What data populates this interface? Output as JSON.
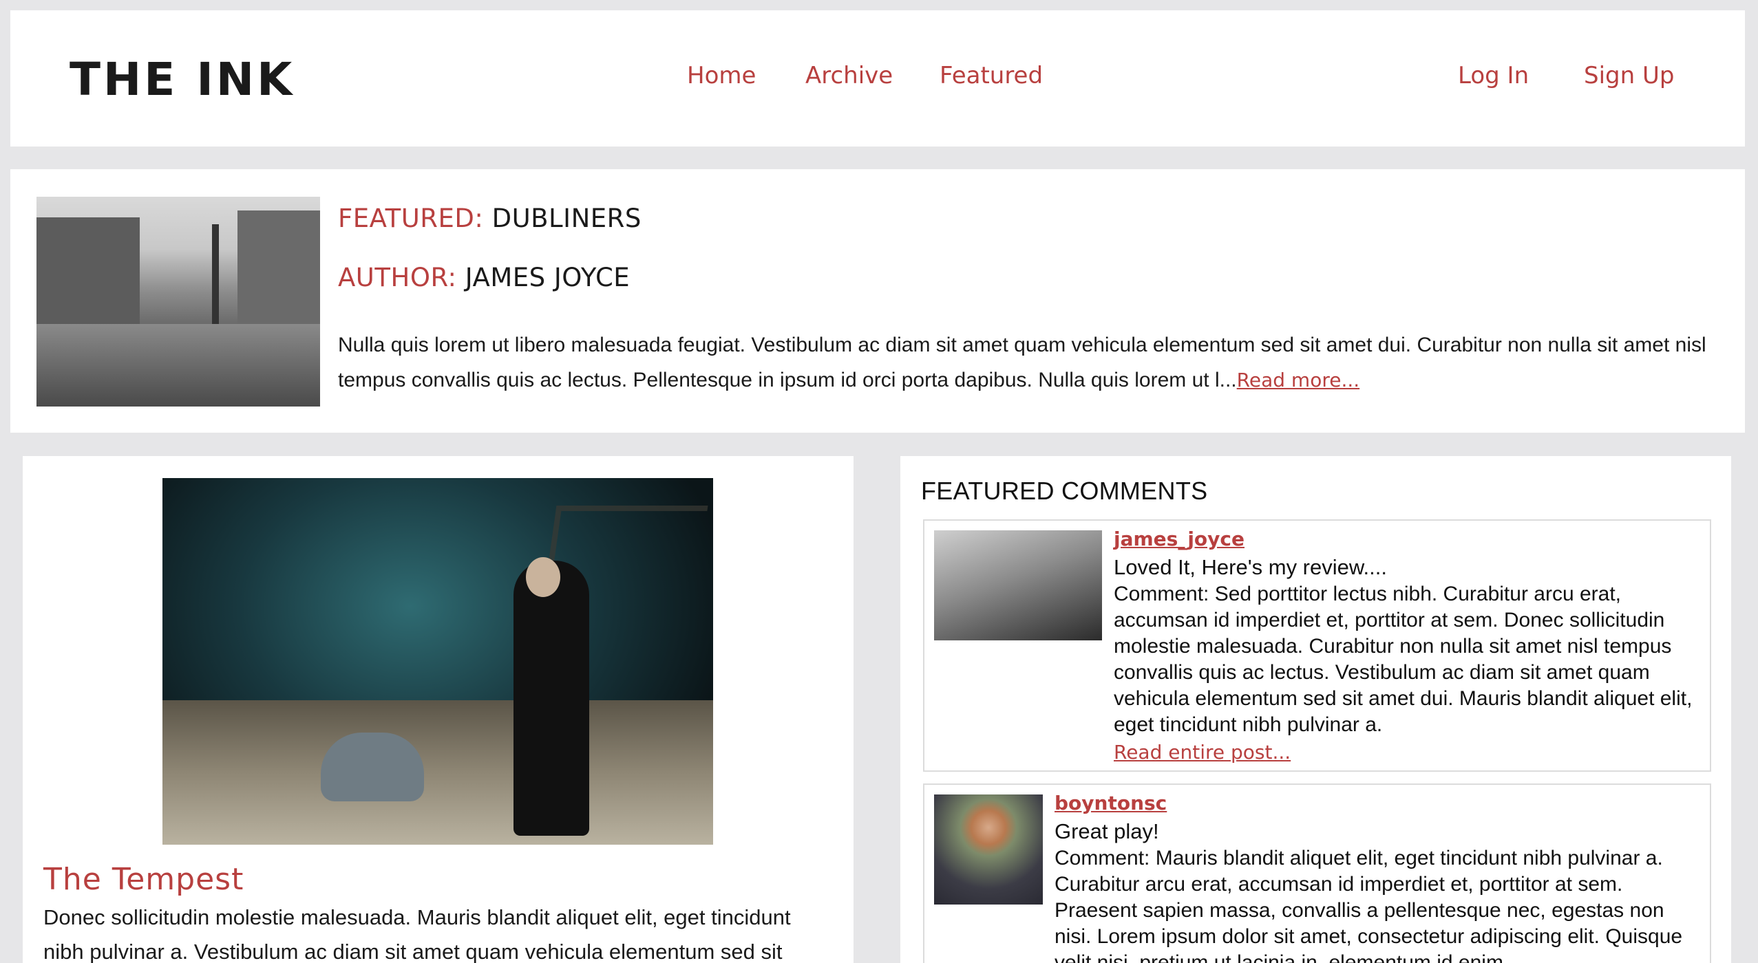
{
  "header": {
    "logo": "THE INK",
    "nav": [
      "Home",
      "Archive",
      "Featured"
    ],
    "auth": [
      "Log In",
      "Sign Up"
    ]
  },
  "feature": {
    "featured_label": "FEATURED:",
    "featured_value": "DUBLINERS",
    "author_label": "AUTHOR:",
    "author_value": "JAMES JOYCE",
    "excerpt": "Nulla quis lorem ut libero malesuada feugiat. Vestibulum ac diam sit amet quam vehicula elementum sed sit amet dui. Curabitur non nulla sit amet nisl tempus convallis quis ac lectus. Pellentesque in ipsum id orci porta dapibus. Nulla quis lorem ut l...",
    "read_more": "Read more..."
  },
  "article": {
    "title": "The Tempest",
    "body": "Donec sollicitudin molestie malesuada. Mauris blandit aliquet elit, eget tincidunt nibh pulvinar a. Vestibulum ac diam sit amet quam vehicula elementum sed sit"
  },
  "comments": {
    "heading": "FEATURED COMMENTS",
    "items": [
      {
        "user": "james_joyce",
        "headline": "Loved It, Here's my review....",
        "text": "Comment: Sed porttitor lectus nibh. Curabitur arcu erat, accumsan id imperdiet et, porttitor at sem. Donec sollicitudin molestie malesuada. Curabitur non nulla sit amet nisl tempus convallis quis ac lectus. Vestibulum ac diam sit amet quam vehicula elementum sed sit amet dui. Mauris blandit aliquet elit, eget tincidunt nibh pulvinar a.",
        "more": "Read entire post..."
      },
      {
        "user": "boyntonsc",
        "headline": "Great play!",
        "text": "Comment: Mauris blandit aliquet elit, eget tincidunt nibh pulvinar a. Curabitur arcu erat, accumsan id imperdiet et, porttitor at sem. Praesent sapien massa, convallis a pellentesque nec, egestas non nisi. Lorem ipsum dolor sit amet, consectetur adipiscing elit. Quisque velit nisi, pretium ut lacinia in, elementum id enim.",
        "more": ""
      }
    ]
  },
  "colors": {
    "accent": "#b8403f",
    "background": "#e6e6e8",
    "card": "#ffffff"
  }
}
